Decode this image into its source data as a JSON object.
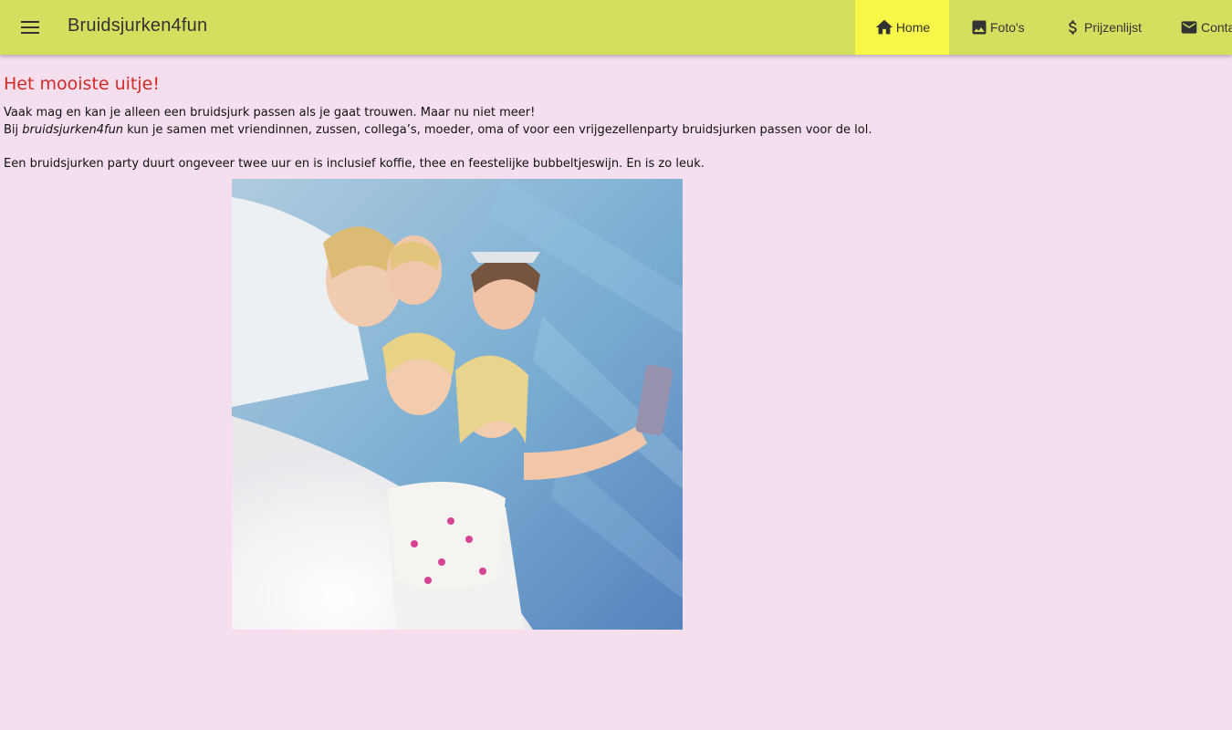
{
  "header": {
    "title": "Bruidsjurken4fun",
    "menu_icon": "menu-icon",
    "nav": [
      {
        "label": "Home",
        "icon": "home-icon",
        "active": true
      },
      {
        "label": "Foto's",
        "icon": "image-icon",
        "active": false
      },
      {
        "label": "Prijzenlijst",
        "icon": "dollar-icon",
        "active": false
      },
      {
        "label": "Conta",
        "icon": "mail-icon",
        "active": false
      }
    ]
  },
  "main": {
    "heading": "Het mooiste uitje!",
    "line1": "Vaak mag en kan je alleen een bruidsjurk passen als je gaat trouwen. Maar nu niet meer!",
    "line2_prefix": "Bij ",
    "line2_brand": "bruidsjurken4fun",
    "line2_suffix": " kun je samen met vriendinnen, zussen, collega’s, moeder, oma of voor een vrijgezellenparty bruidsjurken passen voor de lol.",
    "line3": "Een bruidsjurken party duurt ongeveer twee uur en is inclusief koffie, thee en feestelijke bubbeltjeswijn. En is zo leuk."
  },
  "colors": {
    "appbar": "#d5df5f",
    "active_tab": "#f7f747",
    "page_bg": "#f5dfee",
    "heading": "#d32a25"
  }
}
